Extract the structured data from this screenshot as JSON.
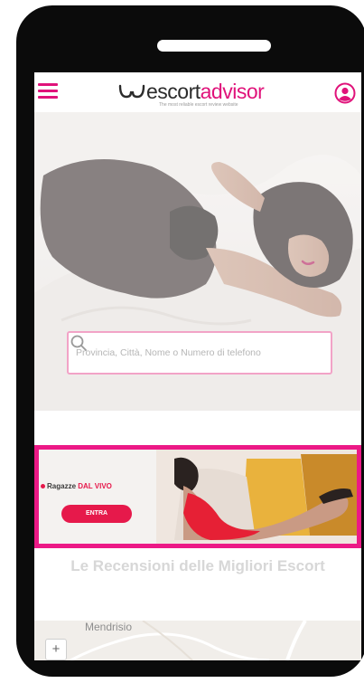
{
  "header": {
    "menu_icon": "hamburger-icon",
    "logo_word1": "escort",
    "logo_word2": "advisor",
    "logo_tagline": "The most reliable escort review website",
    "user_icon": "user-icon",
    "accent_color": "#e0127a"
  },
  "hero": {
    "search_placeholder": "Provincia, Città, Nome o Numero di telefono",
    "search_icon": "search-icon",
    "search_border_color": "#f2a3c7"
  },
  "banner": {
    "label_prefix": "Ragazze ",
    "label_live": "DAL VIVO",
    "cta_label": "ENTRA",
    "frame_color": "#ec1986",
    "cta_color": "#e6194b"
  },
  "section": {
    "title": "Le Recensioni delle Migliori Escort"
  },
  "map": {
    "place_label": "Mendrisio",
    "zoom_in_label": "+"
  }
}
